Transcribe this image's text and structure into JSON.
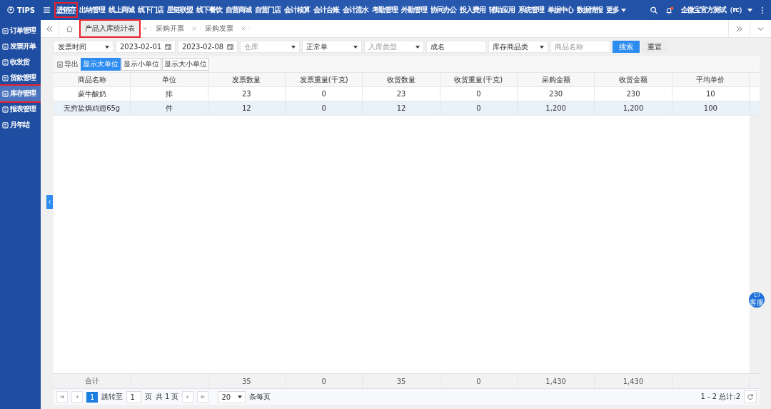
{
  "topbar": {
    "brand": "TIPS",
    "nav": [
      {
        "label": "进销存",
        "selected": true,
        "annotated": true
      },
      {
        "label": "出纳管理",
        "selected": false,
        "annotated": false
      },
      {
        "label": "线上商城",
        "selected": false,
        "annotated": false
      },
      {
        "label": "线下门店",
        "selected": false,
        "annotated": false
      },
      {
        "label": "星链联盟",
        "selected": false,
        "annotated": false
      },
      {
        "label": "线下餐饮",
        "selected": false,
        "annotated": false
      },
      {
        "label": "自营商城",
        "selected": false,
        "annotated": false
      },
      {
        "label": "自营门店",
        "selected": false,
        "annotated": false
      },
      {
        "label": "会计核算",
        "selected": false,
        "annotated": false
      },
      {
        "label": "会计台账",
        "selected": false,
        "annotated": false
      },
      {
        "label": "会计流水",
        "selected": false,
        "annotated": false
      },
      {
        "label": "考勤管理",
        "selected": false,
        "annotated": false
      },
      {
        "label": "外勤管理",
        "selected": false,
        "annotated": false
      },
      {
        "label": "协同办公",
        "selected": false,
        "annotated": false
      },
      {
        "label": "投入费用",
        "selected": false,
        "annotated": false
      },
      {
        "label": "辅助应用",
        "selected": false,
        "annotated": false
      },
      {
        "label": "系统管理",
        "selected": false,
        "annotated": false
      },
      {
        "label": "单据中心",
        "selected": false,
        "annotated": false
      },
      {
        "label": "数据情报",
        "selected": false,
        "annotated": false
      }
    ],
    "more": "更多",
    "user": "企微宝官方测试（rc）",
    "notification": true
  },
  "sidebar": {
    "items": [
      {
        "label": "订单管理",
        "selected": false,
        "annotated": false
      },
      {
        "label": "发票开单",
        "selected": false,
        "annotated": false
      },
      {
        "label": "收发货",
        "selected": false,
        "annotated": false
      },
      {
        "label": "货款管理",
        "selected": false,
        "annotated": false
      },
      {
        "label": "库存管理",
        "selected": true,
        "annotated": true
      },
      {
        "label": "报表管理",
        "selected": false,
        "annotated": false
      },
      {
        "label": "月年结",
        "selected": false,
        "annotated": false
      }
    ]
  },
  "tabs": [
    {
      "label": "产品入库统计表",
      "selected": true,
      "annotated": true
    },
    {
      "label": "采购开票",
      "selected": false,
      "annotated": false
    },
    {
      "label": "采购发票",
      "selected": false,
      "annotated": false
    }
  ],
  "filters": [
    {
      "kind": "select",
      "value": "发票时间"
    },
    {
      "kind": "date",
      "value": "2023-02-01"
    },
    {
      "kind": "date",
      "value": "2023-02-08"
    },
    {
      "kind": "select",
      "placeholder": "仓库"
    },
    {
      "kind": "select",
      "value": "正常单"
    },
    {
      "kind": "select",
      "placeholder": "入库类型"
    },
    {
      "kind": "input",
      "value": "成名"
    },
    {
      "kind": "select",
      "value": "库存商品类"
    },
    {
      "kind": "input",
      "placeholder": "商品名称"
    }
  ],
  "search_button": "搜索",
  "reset_button": "重置",
  "export": "导出",
  "unit_toggles": [
    {
      "label": "显示大单位",
      "selected": true
    },
    {
      "label": "显示小单位",
      "selected": false
    },
    {
      "label": "显示大小单位",
      "selected": false
    }
  ],
  "table": {
    "columns": [
      "商品名称",
      "单位",
      "发票数量",
      "发票重量(千克)",
      "收货数量",
      "收货重量(千克)",
      "采购金额",
      "收货金额",
      "平均单价"
    ],
    "rows": [
      {
        "selected": false,
        "cells": [
          "蒙牛酸奶",
          "排",
          "23",
          "0",
          "23",
          "0",
          "230",
          "230",
          "10"
        ]
      },
      {
        "selected": true,
        "cells": [
          "无穷盐焗鸡翅65g",
          "件",
          "12",
          "0",
          "12",
          "0",
          "1,200",
          "1,200",
          "100"
        ]
      }
    ],
    "totals": {
      "label": "合计",
      "values": [
        "35",
        "0",
        "35",
        "0",
        "1,430",
        "1,430"
      ]
    }
  },
  "pager": {
    "current": "1",
    "jump_label": "跳转至",
    "jump_value": "1",
    "page_unit": "页",
    "total_pages": "共 1 页",
    "page_size": "20",
    "page_size_label": "条每页",
    "summary": "1 - 2 总计:2"
  },
  "chat_button": "客服"
}
